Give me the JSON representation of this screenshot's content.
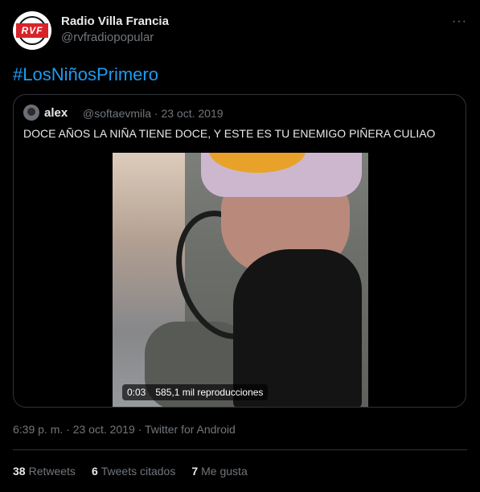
{
  "author": {
    "name": "Radio Villa Francia",
    "handle": "@rvfradiopopular",
    "avatar_text": "RVF"
  },
  "more_icon": "···",
  "tweet": {
    "text": "#LosNiñosPrimero"
  },
  "quoted": {
    "name": "alex",
    "meta": "@softaevmila · 23 oct. 2019",
    "text": "DOCE AÑOS LA NIÑA TIENE DOCE, Y ESTE ES TU ENEMIGO PIÑERA CULIAO",
    "video": {
      "time": "0:03",
      "views": "585,1 mil reproducciones"
    }
  },
  "timestamp": "6:39 p. m. · 23 oct. 2019 · Twitter for Android",
  "stats": {
    "retweets_count": "38",
    "retweets_label": "Retweets",
    "quotes_count": "6",
    "quotes_label": "Tweets citados",
    "likes_count": "7",
    "likes_label": "Me gusta"
  },
  "colors": {
    "background": "#000000",
    "accent": "#1d9bf0",
    "secondary_text": "#71767b",
    "brand_red": "#d8232a"
  }
}
